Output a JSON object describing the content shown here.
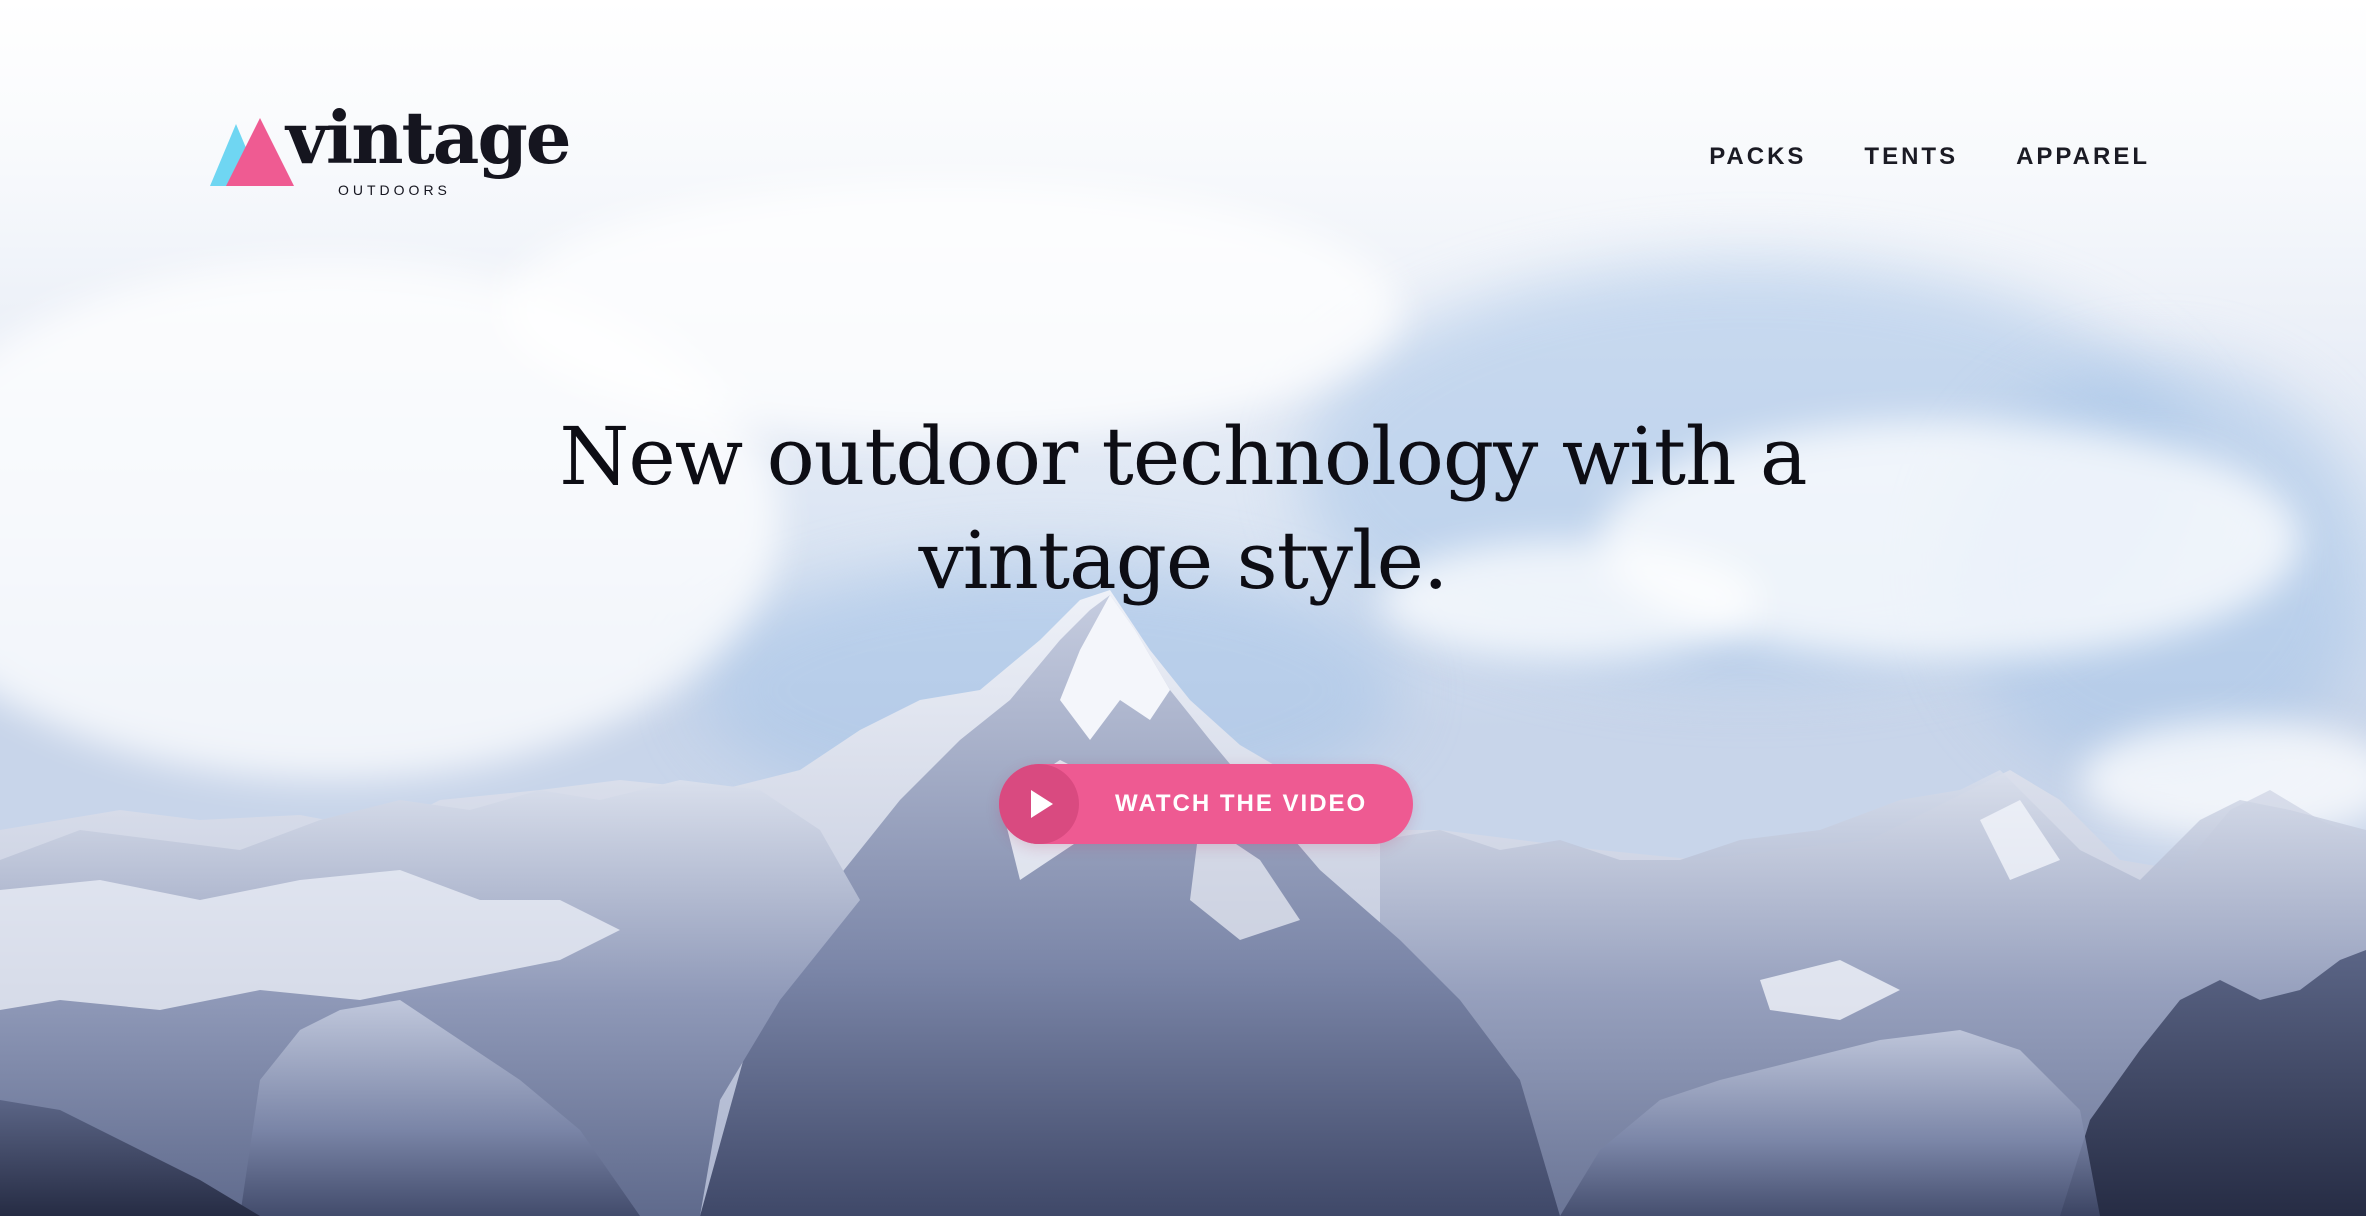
{
  "brand": {
    "name": "vintage",
    "tagline": "OUTDOORS",
    "colors": {
      "pink": "#ef5b92",
      "blue": "#6fd6f2",
      "ink": "#15151f"
    }
  },
  "nav": {
    "items": [
      {
        "label": "PACKS"
      },
      {
        "label": "TENTS"
      },
      {
        "label": "APPAREL"
      }
    ]
  },
  "hero": {
    "headline_line1": "New outdoor technology with a",
    "headline_line2": "vintage style.",
    "background": "snowy-mountain-range-photo",
    "cta": {
      "label": "WATCH THE VIDEO",
      "icon": "play-icon",
      "color": "#ee5a92"
    }
  }
}
